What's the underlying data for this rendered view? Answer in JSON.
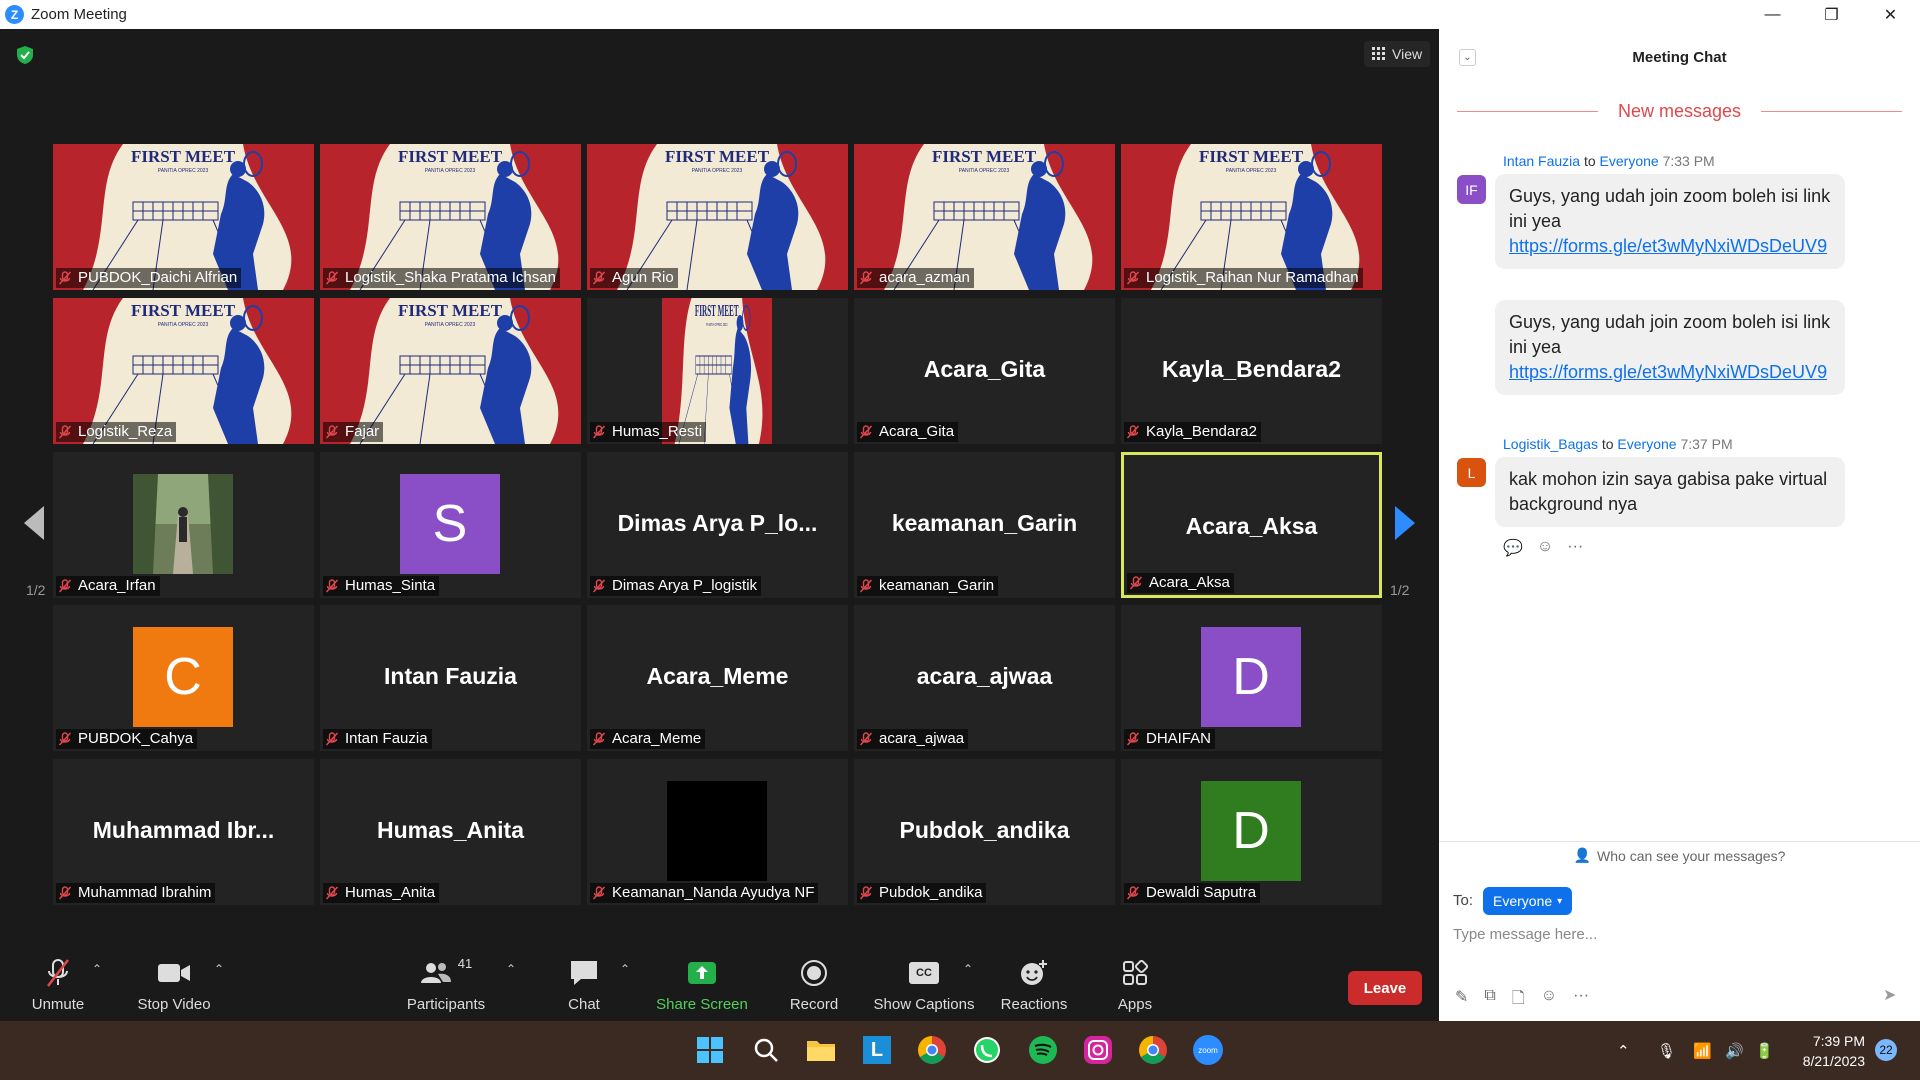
{
  "window": {
    "title": "Zoom Meeting",
    "minimize": "—",
    "restore": "❐",
    "close": "✕"
  },
  "view_label": "View",
  "pagination": {
    "left": "1/2",
    "right": "1/2"
  },
  "tiles": [
    {
      "name": "PUBDOK_Daichi Alfrian",
      "kind": "poster"
    },
    {
      "name": "Logistik_Shaka Pratama Ichsan",
      "kind": "poster"
    },
    {
      "name": "Agun Rio",
      "kind": "poster"
    },
    {
      "name": "acara_azman",
      "kind": "poster"
    },
    {
      "name": "Logistik_Raihan Nur Ramadhan",
      "kind": "poster"
    },
    {
      "name": "Logistik_Reza",
      "kind": "poster"
    },
    {
      "name": "Fajar",
      "kind": "poster"
    },
    {
      "name": "Humas_Resti",
      "kind": "poster-narrow"
    },
    {
      "name": "Acara_Gita",
      "kind": "text",
      "big": "Acara_Gita"
    },
    {
      "name": "Kayla_Bendara2",
      "kind": "text",
      "big": "Kayla_Bendara2"
    },
    {
      "name": "Acara_Irfan",
      "kind": "photo"
    },
    {
      "name": "Humas_Sinta",
      "kind": "avatar",
      "letter": "S",
      "color": "#8a4fc7"
    },
    {
      "name": "Dimas Arya P_logistik",
      "kind": "text",
      "big": "Dimas Arya P_lo..."
    },
    {
      "name": "keamanan_Garin",
      "kind": "text",
      "big": "keamanan_Garin"
    },
    {
      "name": "Acara_Aksa",
      "kind": "text",
      "big": "Acara_Aksa",
      "active": true
    },
    {
      "name": "PUBDOK_Cahya",
      "kind": "avatar",
      "letter": "C",
      "color": "#f07a10"
    },
    {
      "name": "Intan Fauzia",
      "kind": "text",
      "big": "Intan Fauzia"
    },
    {
      "name": "Acara_Meme",
      "kind": "text",
      "big": "Acara_Meme"
    },
    {
      "name": "acara_ajwaa",
      "kind": "text",
      "big": "acara_ajwaa"
    },
    {
      "name": "DHAIFAN",
      "kind": "avatar",
      "letter": "D",
      "color": "#8a4fc7"
    },
    {
      "name": "Muhammad Ibrahim",
      "kind": "text",
      "big": "Muhammad  Ibr..."
    },
    {
      "name": "Humas_Anita",
      "kind": "text",
      "big": "Humas_Anita"
    },
    {
      "name": "Keamanan_Nanda Ayudya NF",
      "kind": "black"
    },
    {
      "name": "Pubdok_andika",
      "kind": "text",
      "big": "Pubdok_andika"
    },
    {
      "name": "Dewaldi Saputra",
      "kind": "avatar",
      "letter": "D",
      "color": "#2f7d1e"
    }
  ],
  "poster_text": {
    "title": "FIRST MEET",
    "subtitle": "PANITIA OPREC 2023"
  },
  "toolbar": {
    "unmute": "Unmute",
    "stop_video": "Stop Video",
    "participants": "Participants",
    "participants_count": "41",
    "chat": "Chat",
    "share_screen": "Share Screen",
    "record": "Record",
    "show_captions": "Show Captions",
    "reactions": "Reactions",
    "apps": "Apps",
    "leave": "Leave",
    "cc": "CC"
  },
  "chat": {
    "title": "Meeting Chat",
    "new_messages": "New messages",
    "groups": [
      {
        "sender": "Intan Fauzia",
        "to": "to",
        "recipient": "Everyone",
        "time": "7:33 PM",
        "initials": "IF",
        "avatar_color": "#8a4fc7",
        "messages": [
          {
            "text": "Guys, yang udah join zoom boleh isi link ini yea",
            "link": "https://forms.gle/et3wMyNxiWDsDeUV9"
          },
          {
            "text": "Guys, yang udah join zoom boleh isi link ini yea",
            "link": "https://forms.gle/et3wMyNxiWDsDeUV9"
          }
        ]
      },
      {
        "sender": "Logistik_Bagas",
        "to": "to",
        "recipient": "Everyone",
        "time": "7:37 PM",
        "initials": "L",
        "avatar_color": "#d9530f",
        "messages": [
          {
            "text": "kak mohon izin saya gabisa pake virtual background nya"
          }
        ]
      }
    ],
    "who_can_see": "Who can see your messages?",
    "to_label": "To:",
    "recipient_select": "Everyone",
    "input_placeholder": "Type message here..."
  },
  "taskbar": {
    "time": "7:39 PM",
    "date": "8/21/2023",
    "notifications": "22"
  }
}
